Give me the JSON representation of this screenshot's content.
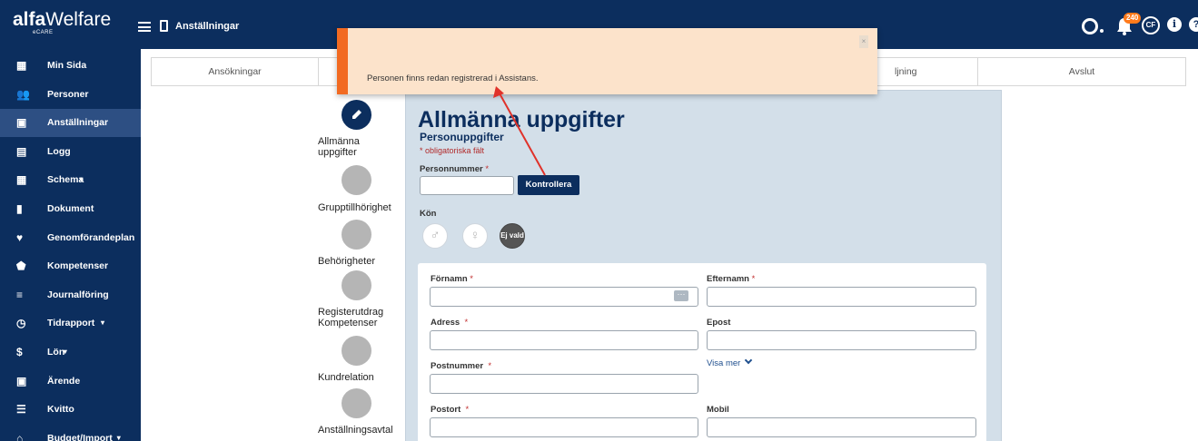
{
  "app": {
    "brand_alfa": "alfa",
    "brand_welfare": "Welfare",
    "brand_sub": "eCARE",
    "section_title": "Anställningar",
    "notification_count": "240",
    "user_initials": "CF"
  },
  "sidebar": {
    "items": [
      {
        "label": "Min Sida",
        "icon": "dashboard-icon"
      },
      {
        "label": "Personer",
        "icon": "people-icon"
      },
      {
        "label": "Anställningar",
        "icon": "briefcase-icon"
      },
      {
        "label": "Logg",
        "icon": "file-icon"
      },
      {
        "label": "Schema",
        "icon": "calendar-icon"
      },
      {
        "label": "Dokument",
        "icon": "document-icon"
      },
      {
        "label": "Genomförandeplan",
        "icon": "heart-icon"
      },
      {
        "label": "Kompetenser",
        "icon": "shield-icon"
      },
      {
        "label": "Journalföring",
        "icon": "journal-icon"
      },
      {
        "label": "Tidrapport",
        "icon": "clock-icon"
      },
      {
        "label": "Lön",
        "icon": "dollar-icon"
      },
      {
        "label": "Ärende",
        "icon": "ticket-icon"
      },
      {
        "label": "Kvitto",
        "icon": "receipt-icon"
      },
      {
        "label": "Budget/Import",
        "icon": "bank-icon"
      }
    ]
  },
  "tabs": [
    "Ansökningar",
    "",
    "",
    "ljning",
    "Avslut"
  ],
  "steps": [
    {
      "label_1": "Allmänna",
      "label_2": "uppgifter"
    },
    {
      "label_1": "Grupptillhörighet",
      "label_2": ""
    },
    {
      "label_1": "Behörigheter",
      "label_2": ""
    },
    {
      "label_1": "Registerutdrag",
      "label_2": "Kompetenser"
    },
    {
      "label_1": "Kundrelation",
      "label_2": ""
    },
    {
      "label_1": "Anställningsavtal",
      "label_2": ""
    }
  ],
  "form": {
    "title": "Allmänna uppgifter",
    "subtitle": "Personuppgifter",
    "required_note": "* obligatoriska fält",
    "personnummer_label": "Personnummer",
    "personnummer_value": "",
    "check_button": "Kontrollera",
    "gender_label": "Kön",
    "gender_none": "Ej vald",
    "fornamn_label": "Förnamn",
    "efternamn_label": "Efternamn",
    "adress_label": "Adress",
    "epost_label": "Epost",
    "postnummer_label": "Postnummer",
    "visa_mer": "Visa mer",
    "postort_label": "Postort",
    "mobil_label": "Mobil",
    "required_mark": "*"
  },
  "toast": {
    "message": "Personen finns redan registrerad i Assistans.",
    "close": "×"
  },
  "colors": {
    "navy": "#0c2e5e",
    "toast_accent": "#f26a21",
    "toast_bg": "#fce3cb",
    "panel_bg": "#d3dfe9",
    "arrow": "#e0322a"
  }
}
